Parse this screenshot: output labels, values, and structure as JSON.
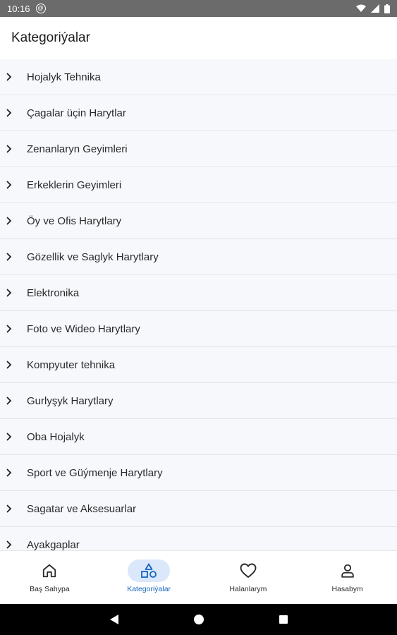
{
  "status_bar": {
    "time": "10:16",
    "notification_icon": "at-sign-icon",
    "icons": [
      "wifi-icon",
      "signal-icon",
      "battery-icon"
    ]
  },
  "app_bar": {
    "title": "Kategoriýalar"
  },
  "categories": [
    {
      "label": "Hojalyk Tehnika"
    },
    {
      "label": "Çagalar üçin Harytlar"
    },
    {
      "label": "Zenanlaryn Geyimleri"
    },
    {
      "label": "Erkeklerin Geyimleri"
    },
    {
      "label": "Öy ve Ofis Harytlary"
    },
    {
      "label": "Gözellik ve Saglyk Harytlary"
    },
    {
      "label": "Elektronika"
    },
    {
      "label": "Foto ve Wideo Harytlary"
    },
    {
      "label": "Kompyuter tehnika"
    },
    {
      "label": "Gurlyşyk Harytlary"
    },
    {
      "label": "Oba Hojalyk"
    },
    {
      "label": "Sport ve Güýmenje Harytlary"
    },
    {
      "label": "Sagatar ve Aksesuarlar"
    },
    {
      "label": "Ayakgaplar"
    }
  ],
  "bottom_nav": {
    "active_index": 1,
    "items": [
      {
        "label": "Baş Sahypa",
        "icon": "home-icon"
      },
      {
        "label": "Kategoriýalar",
        "icon": "categories-shapes-icon"
      },
      {
        "label": "Halanlarym",
        "icon": "heart-icon"
      },
      {
        "label": "Hasabym",
        "icon": "user-icon"
      }
    ]
  },
  "colors": {
    "accent": "#1565c0",
    "active_pill": "#dbe7fb",
    "status_bar": "#6b6b6b",
    "list_bg": "#f6f8fb"
  }
}
